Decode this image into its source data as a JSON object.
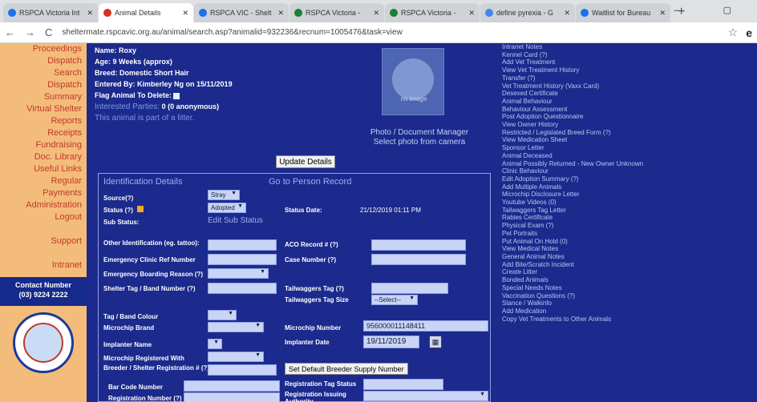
{
  "browser": {
    "tabs": [
      {
        "label": "RSPCA Victoria Int",
        "color": "#1a73e8"
      },
      {
        "label": "Animal Details",
        "color": "#d93025"
      },
      {
        "label": "RSPCA VIC - Shelt",
        "color": "#1a73e8"
      },
      {
        "label": "RSPCA Victoria -",
        "color": "#188038"
      },
      {
        "label": "RSPCA Victoria -",
        "color": "#188038"
      },
      {
        "label": "define pyrexia - G",
        "color": "#4285f4"
      },
      {
        "label": "Waitlist for Bureau",
        "color": "#1a73e8"
      }
    ],
    "new_tab": "+",
    "window_controls": "– ▢",
    "url": "sheltermate.rspcavic.org.au/animal/search.asp?animalid=932236&recnum=1005476&task=view",
    "nav": {
      "back": "←",
      "forward": "→",
      "reload": "C"
    },
    "star": "☆",
    "profile": "e"
  },
  "leftnav": {
    "items": [
      "Proceedings",
      "Dispatch",
      "Search",
      "Dispatch",
      "Summary",
      "Virtual Shelter",
      "Reports",
      "Receipts",
      "Fundraising",
      "Doc. Library",
      "Useful Links",
      "Regular",
      "Payments",
      "Administration",
      "Logout",
      "",
      "Support",
      "",
      "Intranet"
    ],
    "contact_title": "Contact Number",
    "contact_number": "(03) 9224 2222"
  },
  "animal": {
    "name": "Name: Roxy",
    "age": "Age: 9 Weeks (approx)",
    "breed": "Breed: Domestic Short Hair",
    "entered_by": "Entered By: Kimberley Ng on 15/11/2019",
    "flag_delete": "Flag Animal To Delete:",
    "interested": "Interested Parties:",
    "interested_val": "0 (0 anonymous)",
    "litter": "This animal is part of a litter."
  },
  "photo": {
    "caption1": "Photo / Document Manager",
    "caption2": "Select photo from camera",
    "no_image": "no image"
  },
  "update_button": "Update Details",
  "panel": {
    "title": "Identification Details",
    "goto": "Go to Person Record",
    "source_label": "Source(?)",
    "source_val": "Stray",
    "status_label": "Status (?)",
    "status_val": "Adopted",
    "status_date_label": "Status Date:",
    "status_date_val": "21/12/2019 01:11 PM",
    "sub_status_label": "Sub Status:",
    "sub_status_link": "Edit Sub Status",
    "other_id_label": "Other Identification (eg. tattoo):",
    "aco_label": "ACO Record # (?)",
    "emerg_clinic_label": "Emergency Clinic Ref Number",
    "case_label": "Case Number (?)",
    "emerg_board_label": "Emergency Boarding Reason (?)",
    "shelter_tag_label": "Shelter Tag / Band Number (?)",
    "tailwaggers_label": "Tailwaggers Tag (?)",
    "tailwaggers_size_label": "Tailwaggers Tag Size",
    "tailwaggers_size_val": "--Select--",
    "tag_colour_label": "Tag / Band Colour",
    "microchip_brand_label": "Microchip Brand",
    "microchip_num_label": "Microchip Number",
    "microchip_num_val": "956000011148411",
    "implanter_label": "Implanter Name",
    "implanter_date_label": "Implanter Date",
    "implanter_date_val": "19/11/2019",
    "registered_label": "Microchip Registered With",
    "breeder_label": "Breeder / Shelter Registration # (?)",
    "breeder_button": "Set Default Breeder Supply Number",
    "barcode_label": "Bar Code Number",
    "reg_tag_label": "Registration Tag Status",
    "reg_number_label": "Registration Number (?)",
    "reg_issuing_label": "Registration Issuing Authority"
  },
  "right_links": [
    "Intranet Notes",
    "Kennel Card (?)",
    "Add Vet Treatment",
    "View Vet Treatment History",
    "Transfer (?)",
    "Vet Treatment History (Vaxx Card)",
    "Desexed Certificate",
    "Animal Behaviour",
    "Behaviour Assessment",
    "Post Adoption Questionnaire",
    "View Owner History",
    "Restricted / Legislated Breed Form (?)",
    "View Medication Sheet",
    "Sponsor Letter",
    "Animal Deceased",
    "Animal Possibly Returned - New Owner Unknown",
    "Clinic Behaviour",
    "Edit Adoption Summary (?)",
    "Add Multiple Animals",
    "Microchip Disclosure Letter",
    "Youtube Videos (0)",
    "Tailwaggers Tag Letter",
    "Rabies Certificate",
    "Physical Exam (?)",
    "Pet Portraits",
    "Put Animal On Hold (0)",
    "View Medical Notes",
    "General Animal Notes",
    "Add Bite/Scratch Incident",
    "Create Litter",
    "Bonded Animals",
    "Special Needs Notes",
    "Vaccination Questions (?)",
    "Stance / Walkinfo",
    "Add Medication",
    "Copy Vet Treatments to Other Animals"
  ]
}
